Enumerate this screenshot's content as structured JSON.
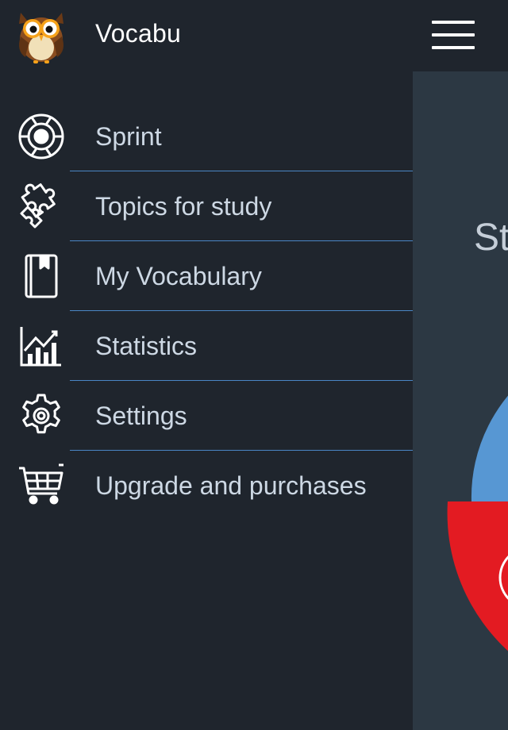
{
  "app": {
    "title": "Vocabu"
  },
  "menu": [
    {
      "label": "Sprint",
      "icon": "sprint-lifebuoy-icon"
    },
    {
      "label": "Topics for study",
      "icon": "puzzle-icon"
    },
    {
      "label": "My Vocabulary",
      "icon": "bookmark-book-icon"
    },
    {
      "label": "Statistics",
      "icon": "bar-chart-icon"
    },
    {
      "label": "Settings",
      "icon": "gear-icon"
    },
    {
      "label": "Upgrade and purchases",
      "icon": "shopping-cart-icon"
    }
  ],
  "main": {
    "heading_partial": "St",
    "pie_colors": {
      "blue": "#5797d3",
      "red": "#e31b22"
    }
  },
  "colors": {
    "drawer_bg": "#1f252d",
    "main_bg": "#2c3843",
    "divider": "#4a86c5",
    "label": "#cdd8e4"
  }
}
